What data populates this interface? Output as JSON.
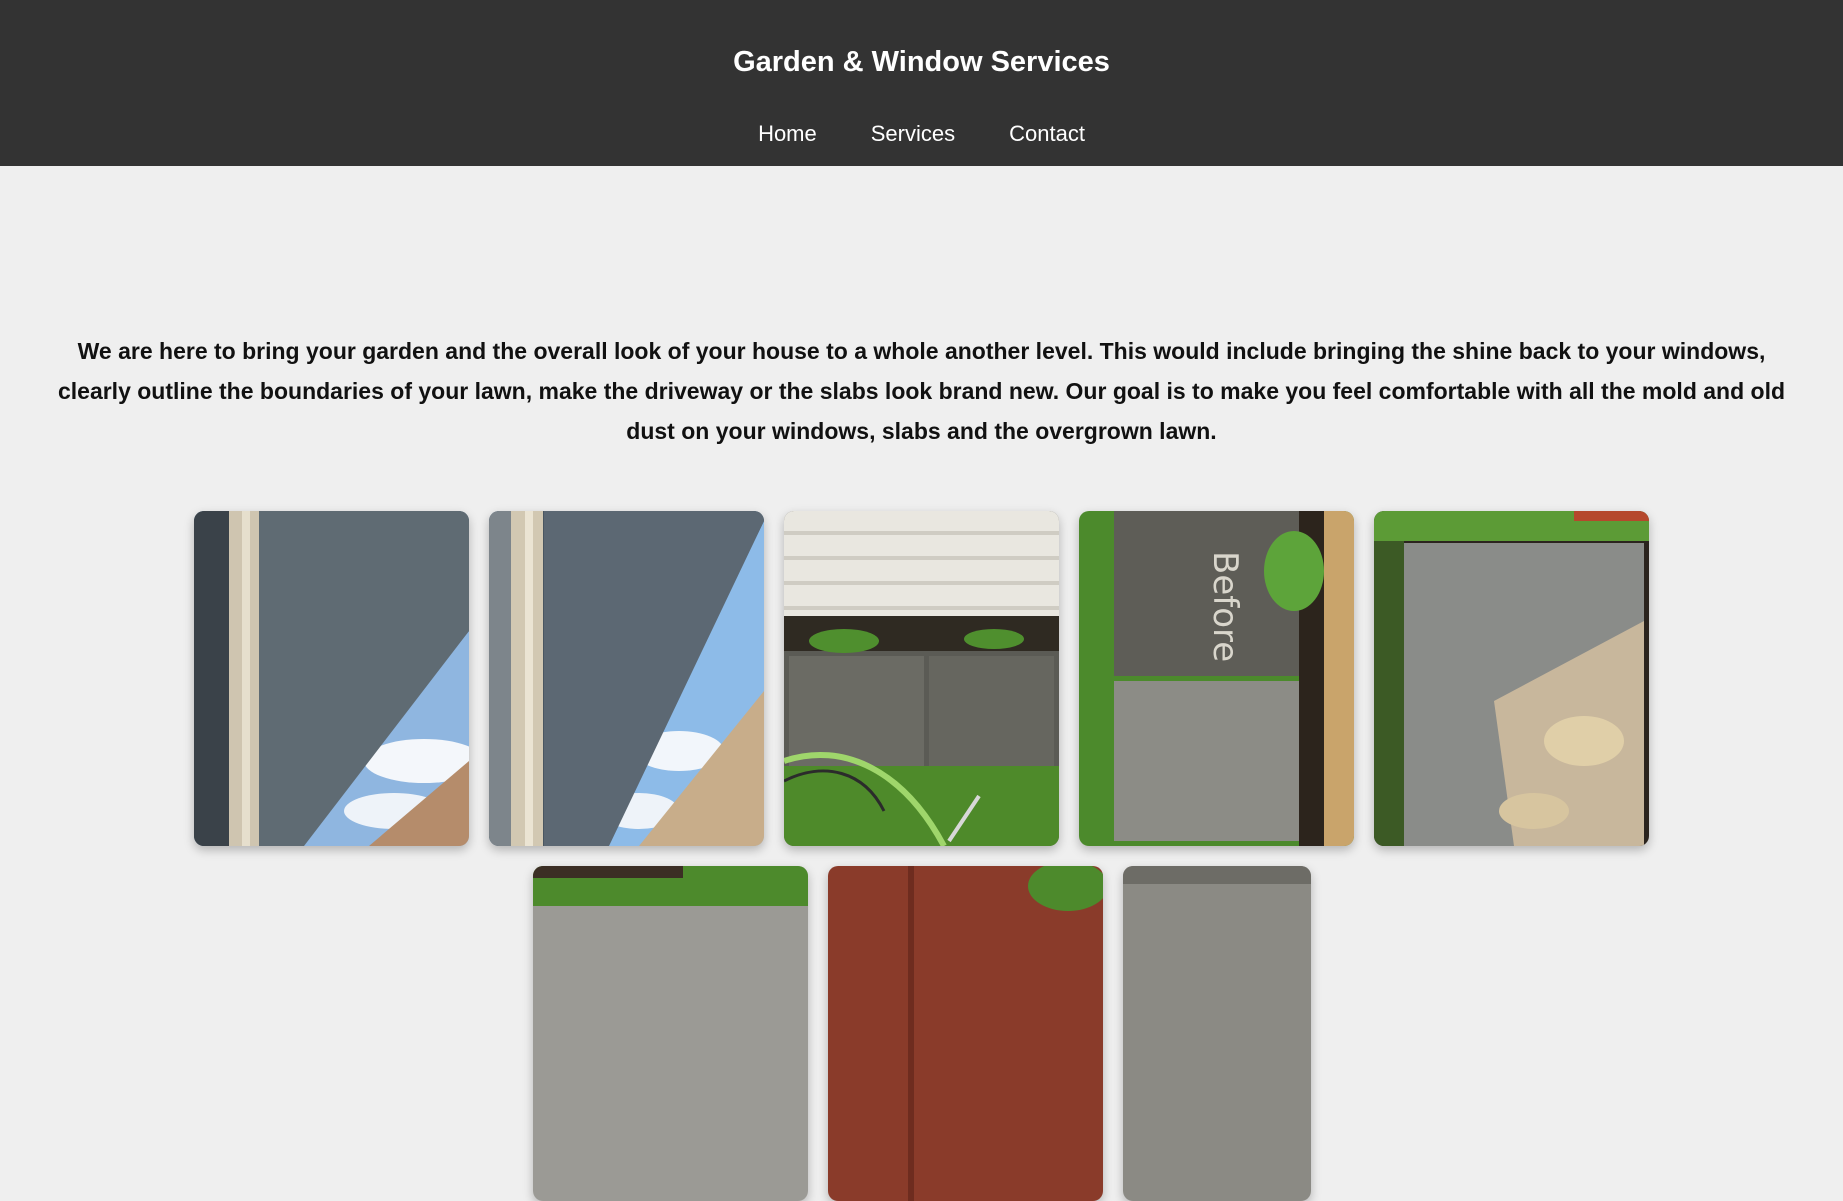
{
  "header": {
    "title": "Garden & Window Services",
    "nav": [
      {
        "label": "Home"
      },
      {
        "label": "Services"
      },
      {
        "label": "Contact"
      }
    ]
  },
  "main": {
    "intro": "We are here to bring your garden and the overall look of your house to a whole another level. This would include bringing the shine back to your windows, clearly outline the boundaries of your lawn, make the driveway or the slabs look brand new. Our goal is to make you feel comfortable with all the mold and old dust on your windows, slabs and the overgrown lawn.",
    "gallery_chalk_text": "Before"
  },
  "colors": {
    "header_bg": "#333333",
    "page_bg": "#efefef",
    "header_text": "#ffffff"
  }
}
